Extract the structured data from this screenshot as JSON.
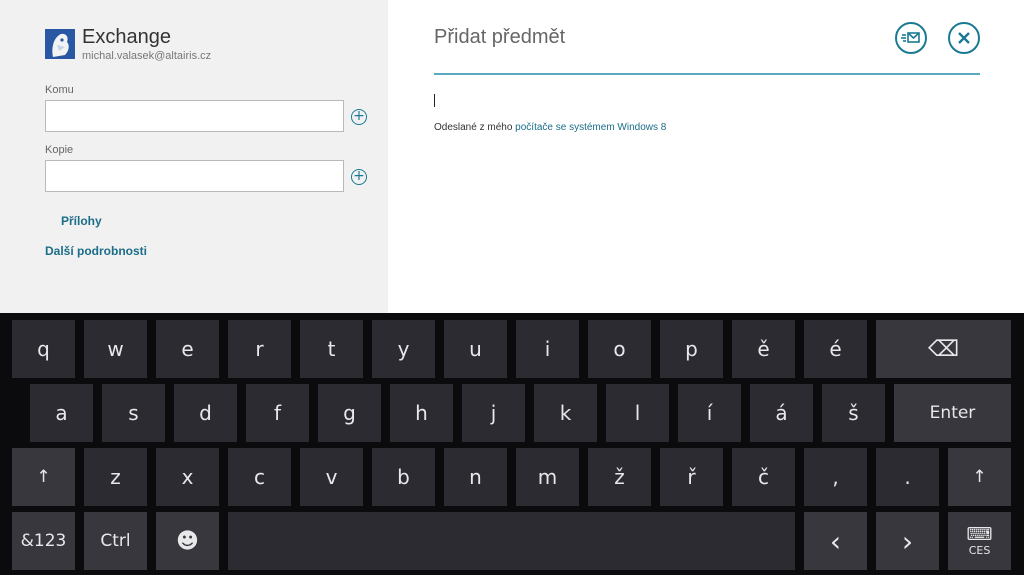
{
  "account": {
    "name": "Exchange",
    "email": "michal.valasek@altairis.cz"
  },
  "compose": {
    "to_label": "Komu",
    "cc_label": "Kopie",
    "to_value": "",
    "cc_value": "",
    "attachments_label": "Přílohy",
    "more_details_label": "Další podrobnosti",
    "subject_placeholder": "Přidat předmět",
    "signature_prefix": "Odeslané z mého ",
    "signature_link": "počítače se systémem Windows 8",
    "add_icon_glyph": "+"
  },
  "icons": {
    "send": "send-mail-icon",
    "close": "close-icon",
    "add": "add-contact-icon",
    "avatar": "exchange-avatar-icon"
  },
  "keyboard": {
    "row1": [
      "q",
      "w",
      "e",
      "r",
      "t",
      "y",
      "u",
      "i",
      "o",
      "p",
      "ě",
      "é"
    ],
    "row2": [
      "a",
      "s",
      "d",
      "f",
      "g",
      "h",
      "j",
      "k",
      "l",
      "í",
      "á",
      "š"
    ],
    "row3": [
      "z",
      "x",
      "c",
      "v",
      "b",
      "n",
      "m",
      "ž",
      "ř",
      "č",
      ",",
      "."
    ],
    "backspace_glyph": "⌫",
    "enter_label": "Enter",
    "shift_glyph": "↑",
    "symbols_label": "&123",
    "ctrl_label": "Ctrl",
    "emoji_glyph": "☻",
    "left_glyph": "‹",
    "right_glyph": "›",
    "keyboard_glyph": "⌨",
    "language_label": "CES"
  },
  "colors": {
    "accent": "#1b7a93",
    "link": "#1b6d88",
    "key": "#2b2b31",
    "keyboard_bg": "#0b0b0d"
  }
}
